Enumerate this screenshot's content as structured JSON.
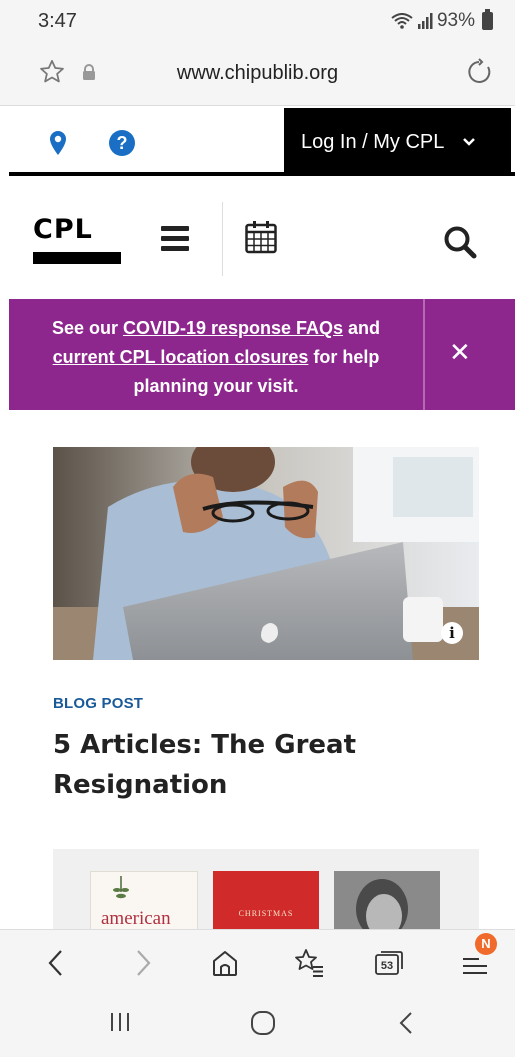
{
  "status_bar": {
    "time": "3:47",
    "battery": "93%"
  },
  "browser": {
    "url": "www.chipublib.org"
  },
  "top_nav": {
    "login_label": "Log In / My CPL"
  },
  "logo": {
    "text": "CPL"
  },
  "alert": {
    "pre": "See our ",
    "link1": "COVID-19 response FAQs",
    "mid": " and ",
    "link2": "current CPL location closures",
    "post": " for help planning your visit."
  },
  "article": {
    "label": "BLOG POST",
    "title": "5 Articles: The Great Resignation"
  },
  "books": [
    {
      "title_text": "american"
    },
    {
      "title_text": "CHRISTMAS"
    }
  ],
  "bottom_nav": {
    "tabs_count": "53",
    "notification_badge": "N"
  },
  "colors": {
    "alert_bg": "#8e278d",
    "login_bg": "#000000",
    "blog_label": "#1a5a99",
    "pin": "#1a6fc4"
  }
}
